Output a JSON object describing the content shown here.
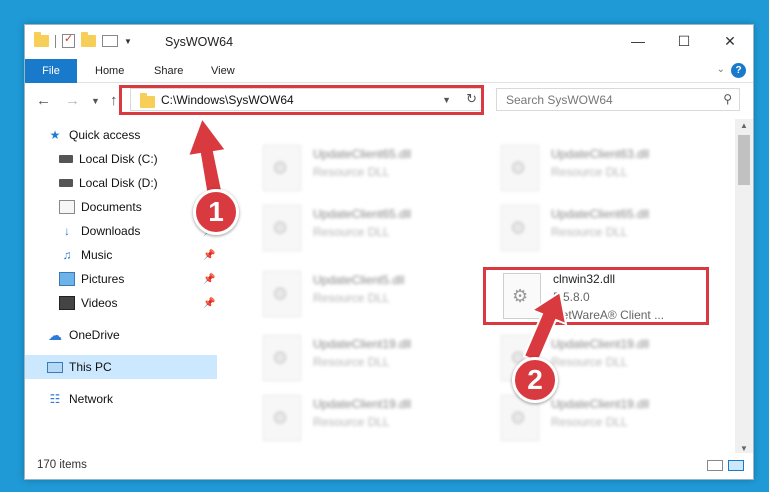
{
  "window": {
    "title": "SysWOW64"
  },
  "ribbon": {
    "tabs": [
      "File",
      "Home",
      "Share",
      "View"
    ]
  },
  "address": {
    "path": "C:\\Windows\\SysWOW64"
  },
  "search": {
    "placeholder": "Search SysWOW64"
  },
  "sidebar": {
    "items": [
      {
        "label": "Quick access",
        "icon": "star-icon"
      },
      {
        "label": "Local Disk (C:)",
        "icon": "drive-icon"
      },
      {
        "label": "Local Disk (D:)",
        "icon": "drive-icon"
      },
      {
        "label": "Documents",
        "icon": "documents-icon"
      },
      {
        "label": "Downloads",
        "icon": "download-icon",
        "pinned": true
      },
      {
        "label": "Music",
        "icon": "music-icon",
        "pinned": true
      },
      {
        "label": "Pictures",
        "icon": "pictures-icon",
        "pinned": true
      },
      {
        "label": "Videos",
        "icon": "videos-icon",
        "pinned": true
      },
      {
        "label": "OneDrive",
        "icon": "cloud-icon"
      },
      {
        "label": "This PC",
        "icon": "computer-icon",
        "selected": true
      },
      {
        "label": "Network",
        "icon": "network-icon"
      }
    ]
  },
  "files": [
    {
      "name": "UpdateClient65.dll",
      "type": "Resource DLL"
    },
    {
      "name": "UpdateClient63.dll",
      "type": "Resource DLL"
    },
    {
      "name": "UpdateClient65.dll",
      "type": "Resource DLL"
    },
    {
      "name": "UpdateClient65.dll",
      "type": "Resource DLL"
    },
    {
      "name": "UpdateClient5.dll",
      "type": "Resource DLL"
    },
    {
      "name": "clnwin32.dll",
      "version": "5.5.8.0",
      "type": "NetWareA® Client ..."
    },
    {
      "name": "UpdateClient19.dll",
      "type": "Resource DLL"
    },
    {
      "name": "UpdateClient19.dll",
      "type": "Resource DLL"
    },
    {
      "name": "UpdateClient19.dll",
      "type": "Resource DLL"
    },
    {
      "name": "UpdateClient19.dll",
      "type": "Resource DLL"
    }
  ],
  "status": {
    "item_count": "170 items"
  },
  "annotations": {
    "step1": "1",
    "step2": "2"
  },
  "colors": {
    "accent": "#1979ca",
    "highlight": "#d83a3f",
    "desktop": "#1f9ad6"
  }
}
